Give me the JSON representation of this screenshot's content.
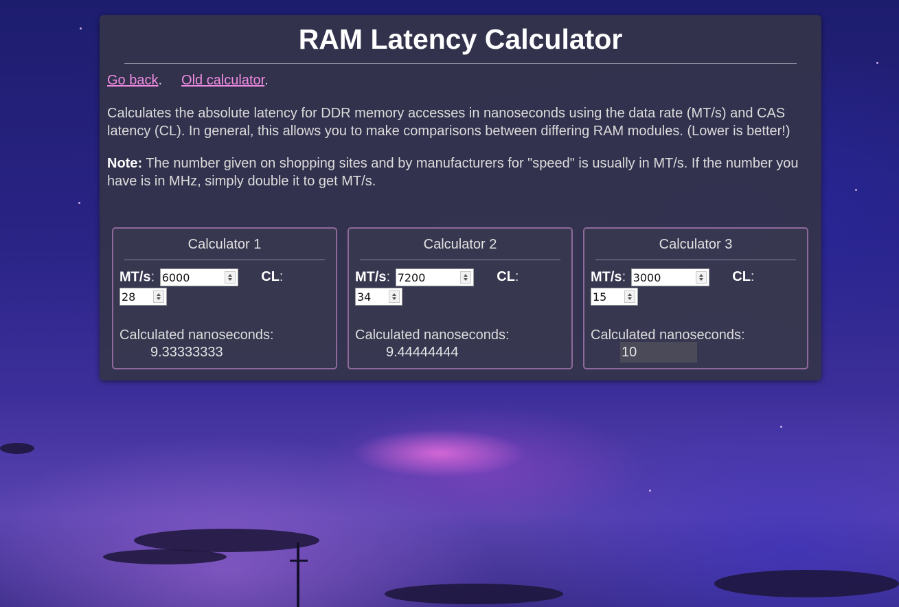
{
  "page": {
    "title": "RAM Latency Calculator",
    "links": [
      {
        "label": "Go back",
        "suffix": "."
      },
      {
        "label": "Old calculator",
        "suffix": "."
      }
    ],
    "description": "Calculates the absolute latency for DDR memory accesses in nanoseconds using the data rate (MT/s) and CAS latency (CL). In general, this allows you to make comparisons between differing RAM modules. (Lower is better!)",
    "note_label": "Note:",
    "note_text": " The number given on shopping sites and by manufacturers for \"speed\" is usually in MT/s. If the number you have is in MHz, simply double it to get MT/s."
  },
  "labels": {
    "mts": "MT/s",
    "cl": "CL",
    "colon": ":",
    "result": "Calculated nanoseconds:"
  },
  "calculators": [
    {
      "title": "Calculator 1",
      "mts": "6000",
      "cl": "28",
      "result": "9.33333333"
    },
    {
      "title": "Calculator 2",
      "mts": "7200",
      "cl": "34",
      "result": "9.44444444"
    },
    {
      "title": "Calculator 3",
      "mts": "3000",
      "cl": "15",
      "result": "10"
    }
  ]
}
